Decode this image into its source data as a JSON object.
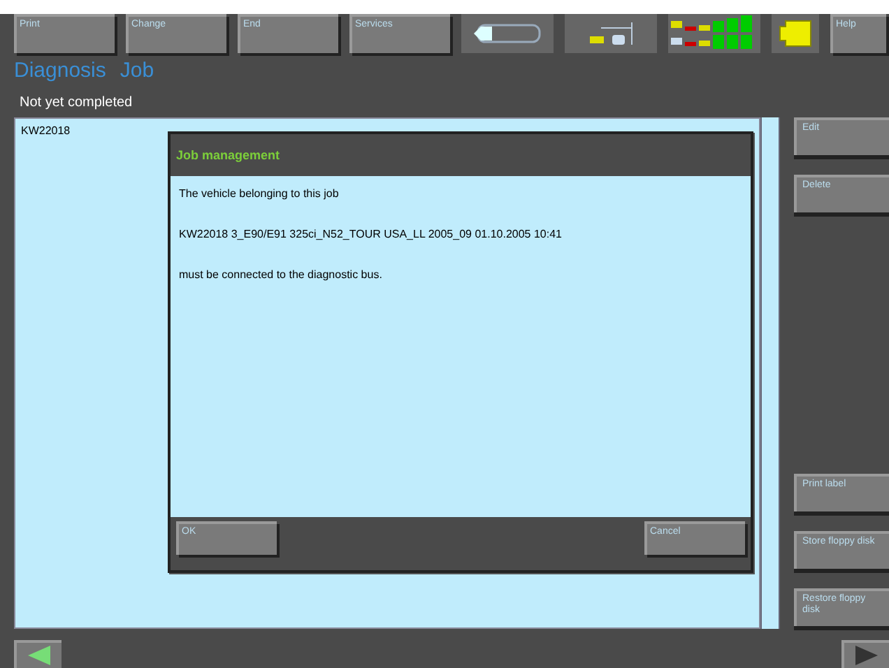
{
  "toolbar": {
    "buttons": [
      "Print",
      "Change",
      "End",
      "Services"
    ],
    "help": "Help"
  },
  "title": [
    "Diagnosis",
    "Job"
  ],
  "section": "Not yet completed",
  "rows": [
    {
      "id": "KW22018",
      "selected": false
    }
  ],
  "side_buttons": {
    "upper": [
      "Edit",
      "Delete"
    ],
    "lower": [
      "Print label",
      "Store floppy disk",
      "Restore floppy disk"
    ]
  },
  "dialog": {
    "title": "Job management",
    "lines": [
      "The vehicle belonging to this job",
      "KW22018  3_E90/E91  325ci_N52_TOUR  USA_LL  2005_09  01.10.2005  10:41",
      "must be connected to the diagnostic bus."
    ],
    "ok": "OK",
    "cancel": "Cancel"
  }
}
